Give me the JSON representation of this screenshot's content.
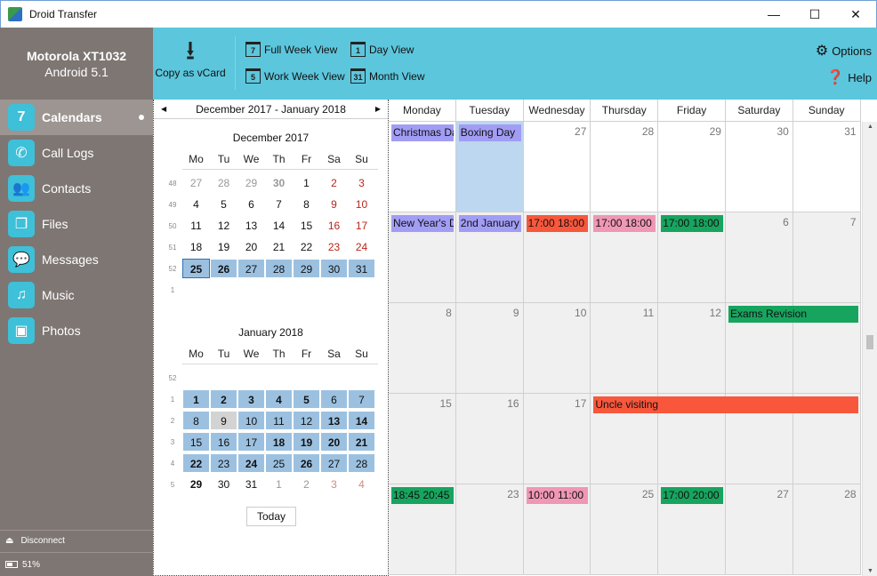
{
  "window": {
    "title": "Droid Transfer",
    "minimize": "—",
    "maximize": "☐",
    "close": "✕"
  },
  "device": {
    "name": "Motorola XT1032",
    "os": "Android 5.1"
  },
  "nav": [
    {
      "label": "Calendars",
      "icon": "calendar-icon",
      "glyph": "7",
      "active": true
    },
    {
      "label": "Call Logs",
      "icon": "phone-icon",
      "glyph": "✆"
    },
    {
      "label": "Contacts",
      "icon": "contacts-icon",
      "glyph": "👥"
    },
    {
      "label": "Files",
      "icon": "files-icon",
      "glyph": "❐"
    },
    {
      "label": "Messages",
      "icon": "messages-icon",
      "glyph": "💬"
    },
    {
      "label": "Music",
      "icon": "music-icon",
      "glyph": "♫"
    },
    {
      "label": "Photos",
      "icon": "photos-icon",
      "glyph": "▣"
    }
  ],
  "footer": {
    "disconnect": "Disconnect",
    "battery": "51%"
  },
  "toolbar": {
    "copy_vcard": "Copy as vCard",
    "full_week": {
      "label": "Full Week View",
      "num": "7"
    },
    "work_week": {
      "label": "Work Week View",
      "num": "5"
    },
    "day_view": {
      "label": "Day View",
      "num": "1"
    },
    "month_view": {
      "label": "Month View",
      "num": "31"
    },
    "options": "Options",
    "help": "Help"
  },
  "minical": {
    "range": "December 2017 - January 2018",
    "weekdays": [
      "Mo",
      "Tu",
      "We",
      "Th",
      "Fr",
      "Sa",
      "Su"
    ],
    "today_button": "Today",
    "months": [
      {
        "title": "December 2017",
        "weeks": [
          {
            "wk": "48",
            "days": [
              [
                "27",
                "grey"
              ],
              [
                "28",
                "grey"
              ],
              [
                "29",
                "grey"
              ],
              [
                "30",
                "grey bold"
              ],
              [
                "1",
                ""
              ],
              [
                "2",
                "red"
              ],
              [
                "3",
                "red"
              ]
            ]
          },
          {
            "wk": "49",
            "days": [
              [
                "4",
                ""
              ],
              [
                "5",
                ""
              ],
              [
                "6",
                ""
              ],
              [
                "7",
                ""
              ],
              [
                "8",
                ""
              ],
              [
                "9",
                "red"
              ],
              [
                "10",
                "red"
              ]
            ]
          },
          {
            "wk": "50",
            "days": [
              [
                "11",
                ""
              ],
              [
                "12",
                ""
              ],
              [
                "13",
                ""
              ],
              [
                "14",
                ""
              ],
              [
                "15",
                ""
              ],
              [
                "16",
                "red"
              ],
              [
                "17",
                "red"
              ]
            ]
          },
          {
            "wk": "51",
            "days": [
              [
                "18",
                ""
              ],
              [
                "19",
                ""
              ],
              [
                "20",
                ""
              ],
              [
                "21",
                ""
              ],
              [
                "22",
                ""
              ],
              [
                "23",
                "red"
              ],
              [
                "24",
                "red"
              ]
            ]
          },
          {
            "wk": "52",
            "days": [
              [
                "25",
                "sel bold curr"
              ],
              [
                "26",
                "sel bold"
              ],
              [
                "27",
                "sel"
              ],
              [
                "28",
                "sel"
              ],
              [
                "29",
                "sel"
              ],
              [
                "30",
                "sel"
              ],
              [
                "31",
                "sel"
              ]
            ]
          },
          {
            "wk": "1",
            "days": []
          }
        ]
      },
      {
        "title": "January 2018",
        "weeks": [
          {
            "wk": "52",
            "days": []
          },
          {
            "wk": "1",
            "days": [
              [
                "1",
                "sel bold"
              ],
              [
                "2",
                "sel bold"
              ],
              [
                "3",
                "sel bold"
              ],
              [
                "4",
                "sel bold"
              ],
              [
                "5",
                "sel bold"
              ],
              [
                "6",
                "sel"
              ],
              [
                "7",
                "sel"
              ]
            ]
          },
          {
            "wk": "2",
            "days": [
              [
                "8",
                "sel"
              ],
              [
                "9",
                "today"
              ],
              [
                "10",
                "sel"
              ],
              [
                "11",
                "sel"
              ],
              [
                "12",
                "sel"
              ],
              [
                "13",
                "sel bold"
              ],
              [
                "14",
                "sel bold"
              ]
            ]
          },
          {
            "wk": "3",
            "days": [
              [
                "15",
                "sel"
              ],
              [
                "16",
                "sel"
              ],
              [
                "17",
                "sel"
              ],
              [
                "18",
                "sel bold"
              ],
              [
                "19",
                "sel bold"
              ],
              [
                "20",
                "sel bold"
              ],
              [
                "21",
                "sel bold"
              ]
            ]
          },
          {
            "wk": "4",
            "days": [
              [
                "22",
                "sel bold"
              ],
              [
                "23",
                "sel"
              ],
              [
                "24",
                "sel bold"
              ],
              [
                "25",
                "sel"
              ],
              [
                "26",
                "sel bold"
              ],
              [
                "27",
                "sel"
              ],
              [
                "28",
                "sel"
              ]
            ]
          },
          {
            "wk": "5",
            "days": [
              [
                "29",
                "bold"
              ],
              [
                "30",
                ""
              ],
              [
                "31",
                ""
              ],
              [
                "1",
                "grey"
              ],
              [
                "2",
                "grey"
              ],
              [
                "3",
                "pale"
              ],
              [
                "4",
                "pale"
              ]
            ]
          }
        ]
      }
    ]
  },
  "month_view": {
    "day_headers": [
      "Monday",
      "Tuesday",
      "Wednesday",
      "Thursday",
      "Friday",
      "Saturday",
      "Sunday"
    ],
    "weeks": [
      [
        "",
        "",
        "27",
        "28",
        "29",
        "30",
        "31"
      ],
      [
        "",
        "",
        "",
        "",
        "",
        "6",
        "7"
      ],
      [
        "8",
        "9",
        "10",
        "11",
        "12",
        "",
        ""
      ],
      [
        "15",
        "16",
        "17",
        "",
        "",
        "",
        ""
      ],
      [
        "",
        "23",
        "",
        "25",
        "",
        "27",
        "28"
      ]
    ],
    "cell_styles": [
      [
        "prev",
        "hl",
        "prev",
        "prev",
        "prev",
        "prev",
        "prev"
      ],
      [
        "inm",
        "inm",
        "inm",
        "inm",
        "inm",
        "inm",
        "inm"
      ],
      [
        "inm",
        "inm",
        "inm",
        "inm",
        "inm",
        "inm",
        "inm"
      ],
      [
        "inm",
        "inm",
        "inm",
        "inm",
        "inm",
        "inm",
        "inm"
      ],
      [
        "inm",
        "inm",
        "inm",
        "inm",
        "inm",
        "inm",
        "inm"
      ]
    ],
    "events": [
      {
        "row": 0,
        "col": 0,
        "span": 1,
        "text": "Christmas Day",
        "color": "lav"
      },
      {
        "row": 0,
        "col": 1,
        "span": 1,
        "text": "Boxing Day",
        "color": "lav"
      },
      {
        "row": 1,
        "col": 0,
        "span": 1,
        "text": "New Year's Day",
        "color": "lav"
      },
      {
        "row": 1,
        "col": 1,
        "span": 1,
        "text": "2nd January",
        "color": "lav"
      },
      {
        "row": 1,
        "col": 2,
        "span": 1,
        "text": "17:00  18:00",
        "color": "red"
      },
      {
        "row": 1,
        "col": 3,
        "span": 1,
        "text": "17:00  18:00",
        "color": "pink"
      },
      {
        "row": 1,
        "col": 4,
        "span": 1,
        "text": "17:00  18:00",
        "color": "green"
      },
      {
        "row": 2,
        "col": 5,
        "span": 2,
        "text": "Exams Revision",
        "color": "green"
      },
      {
        "row": 3,
        "col": 3,
        "span": 4,
        "text": "Uncle visiting",
        "color": "red"
      },
      {
        "row": 4,
        "col": 0,
        "span": 1,
        "text": "18:45  20:45",
        "color": "green"
      },
      {
        "row": 4,
        "col": 2,
        "span": 1,
        "text": "10:00  11:00",
        "color": "pink"
      },
      {
        "row": 4,
        "col": 4,
        "span": 1,
        "text": "17:00  20:00",
        "color": "green"
      }
    ]
  }
}
